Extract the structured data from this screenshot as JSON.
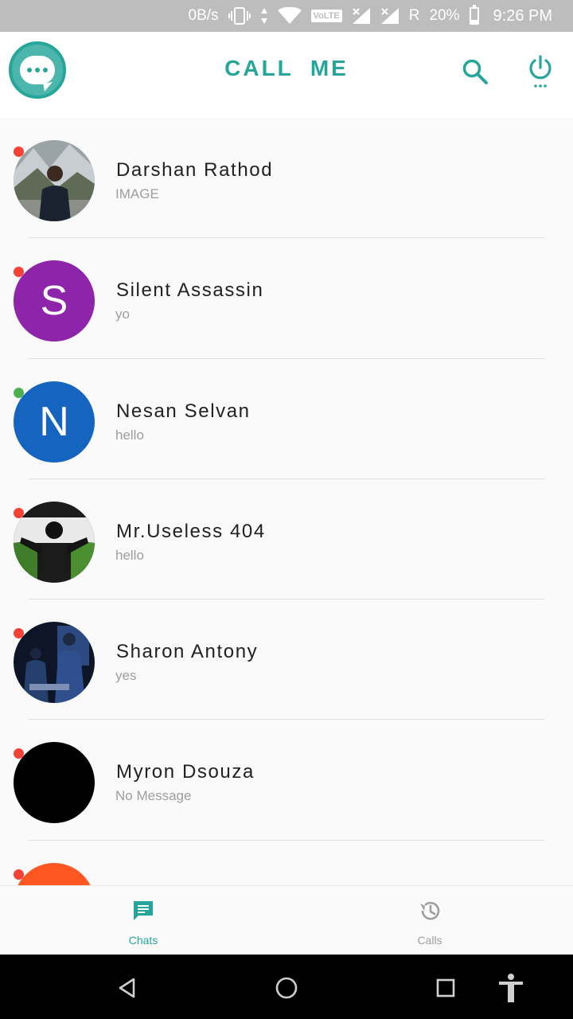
{
  "status_bar": {
    "net_speed": "0B/s",
    "volte": "VoLTE",
    "roaming": "R",
    "battery": "20%",
    "battery_level": 0.2,
    "time": "9:26 PM"
  },
  "app_bar": {
    "title": "CALL  ME",
    "icons": [
      "chat-logo-icon",
      "search-icon",
      "power-icon"
    ],
    "accent_color": "#26a69a"
  },
  "chats": [
    {
      "name": "Darshan Rathod",
      "message": "IMAGE",
      "status_color": "#f44336",
      "avatar_letter": "",
      "avatar_kind": "photo-mountain"
    },
    {
      "name": "Silent Assassin",
      "message": "yo",
      "status_color": "#f44336",
      "avatar_letter": "S",
      "avatar_color": "#8e24aa"
    },
    {
      "name": "Nesan Selvan",
      "message": "hello",
      "status_color": "#4caf50",
      "avatar_letter": "N",
      "avatar_color": "#1565c0"
    },
    {
      "name": "Mr.Useless 404",
      "message": "hello",
      "status_color": "#f44336",
      "avatar_letter": "",
      "avatar_kind": "photo-green"
    },
    {
      "name": "Sharon Antony",
      "message": "yes",
      "status_color": "#f44336",
      "avatar_letter": "",
      "avatar_kind": "photo-night"
    },
    {
      "name": "Myron Dsouza",
      "message": "No Message",
      "status_color": "#f44336",
      "avatar_letter": "",
      "avatar_color": "#000000"
    },
    {
      "name": "",
      "message": "",
      "status_color": "#f44336",
      "avatar_letter": "",
      "avatar_color": "#ff5722"
    }
  ],
  "bottom_nav": {
    "chats_label": "Chats",
    "calls_label": "Calls",
    "active_color": "#26a69a",
    "inactive_color": "#9e9e9e"
  },
  "system_nav": {
    "icons": [
      "back-icon",
      "home-icon",
      "recents-icon",
      "accessibility-icon"
    ]
  }
}
